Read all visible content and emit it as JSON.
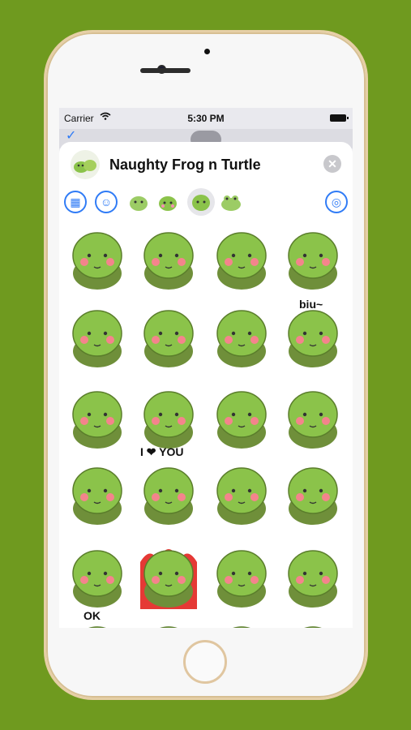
{
  "status_bar": {
    "carrier": "Carrier",
    "time": "5:30 PM"
  },
  "sheet": {
    "title": "Naughty Frog n Turtle"
  },
  "tabs": [
    {
      "name": "recent-grid-icon",
      "selected": false
    },
    {
      "name": "smiley-icon",
      "selected": false
    },
    {
      "name": "frog-pack-1",
      "selected": false
    },
    {
      "name": "frog-pack-2",
      "selected": false
    },
    {
      "name": "turtle-pack",
      "selected": true
    },
    {
      "name": "frog-pack-3",
      "selected": false
    },
    {
      "name": "sticker-scan-icon",
      "selected": false
    }
  ],
  "stickers": {
    "captions": {
      "biu": "biu~",
      "i_love_you": "I ❤ YOU",
      "ok": "OK"
    },
    "count": 24
  },
  "colors": {
    "background": "#6f9a1f",
    "turtle": "#8bc34a",
    "accent": "#2f7bf6"
  }
}
